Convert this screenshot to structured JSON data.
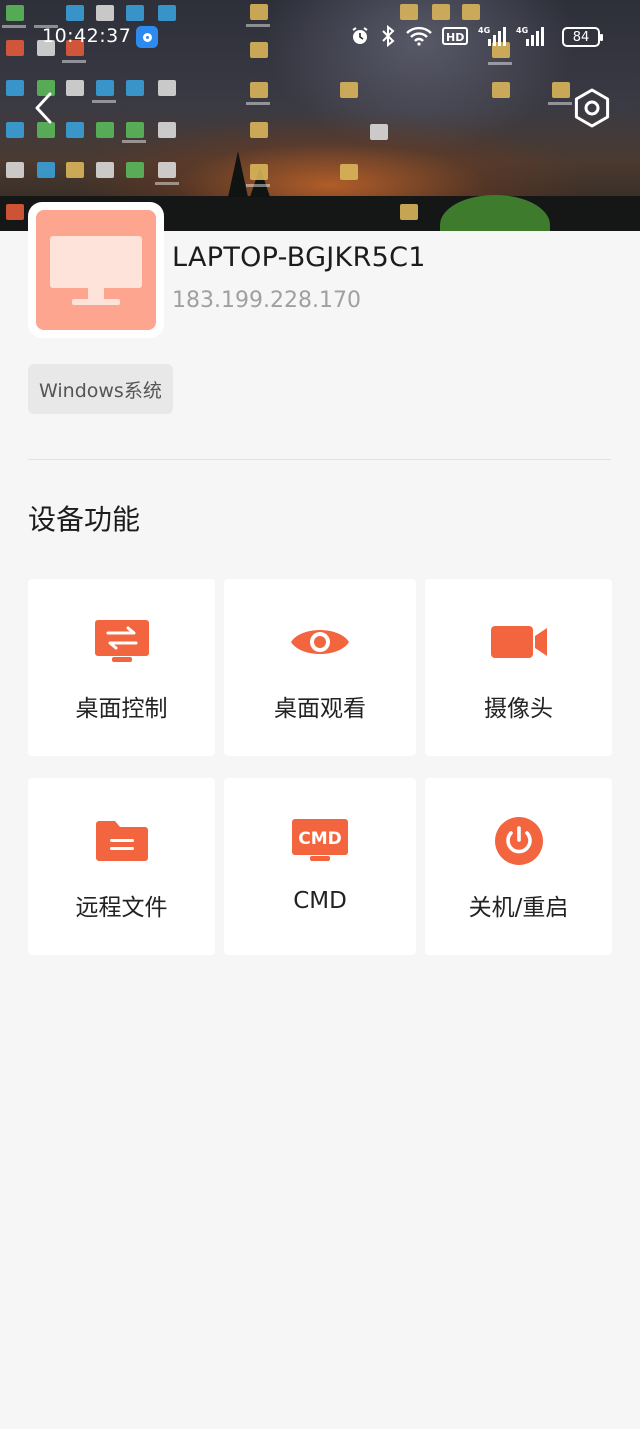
{
  "status_bar": {
    "time": "10:42:37",
    "battery": "84",
    "icons": [
      "app-notification-icon",
      "alarm-icon",
      "bluetooth-icon",
      "wifi-icon",
      "hd-icon",
      "signal-4g-icon",
      "signal-4g-icon"
    ]
  },
  "header": {
    "back_icon": "chevron-left-icon",
    "settings_icon": "hexagon-settings-icon"
  },
  "device": {
    "name": "LAPTOP-BGJKR5C1",
    "ip": "183.199.228.170",
    "os": "Windows系统",
    "icon": "monitor-icon"
  },
  "section_title": "设备功能",
  "functions": [
    {
      "label": "桌面控制",
      "icon": "desktop-control-icon"
    },
    {
      "label": "桌面观看",
      "icon": "eye-icon"
    },
    {
      "label": "摄像头",
      "icon": "video-camera-icon"
    },
    {
      "label": "远程文件",
      "icon": "folder-icon"
    },
    {
      "label": "CMD",
      "icon": "cmd-icon",
      "icon_text": "CMD"
    },
    {
      "label": "关机/重启",
      "icon": "power-icon"
    }
  ],
  "colors": {
    "accent": "#f2653f",
    "device_tile": "#fda58e",
    "background": "#f6f6f6",
    "os_badge_bg": "#e8e8e8",
    "ip_text": "#a0a0a0"
  }
}
